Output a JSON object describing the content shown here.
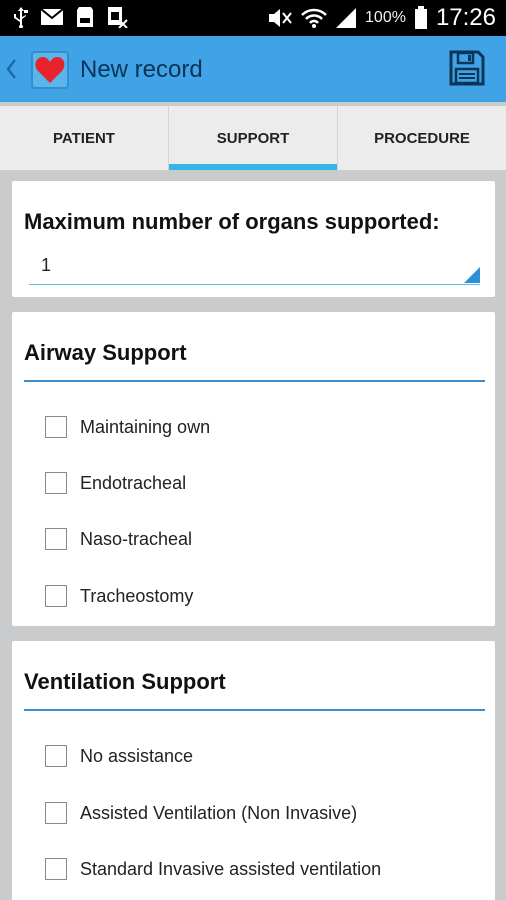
{
  "status_bar": {
    "battery_percent": "100%",
    "time": "17:26",
    "icons": [
      "usb-icon",
      "mail-icon",
      "storage-icon",
      "sim-off-icon",
      "mute-icon",
      "wifi-icon",
      "signal-icon",
      "battery-icon"
    ]
  },
  "action_bar": {
    "title": "New record",
    "back_icon": "chevron-left-icon",
    "app_icon": "heart-icon",
    "save_icon": "floppy-disk-icon",
    "color": "#3fa3e6"
  },
  "tabs": [
    {
      "label": "PATIENT",
      "active": false
    },
    {
      "label": "SUPPORT",
      "active": true
    },
    {
      "label": "PROCEDURE",
      "active": false
    }
  ],
  "organs": {
    "label": "Maximum number of organs supported:",
    "selected": "1"
  },
  "airway": {
    "title": "Airway Support",
    "options": [
      "Maintaining own",
      "Endotracheal",
      "Naso-tracheal",
      "Tracheostomy"
    ]
  },
  "ventilation": {
    "title": "Ventilation Support",
    "options": [
      "No assistance",
      "Assisted Ventilation (Non Invasive)",
      "Standard Invasive assisted ventilation"
    ]
  },
  "colors": {
    "accent": "#33b5e5",
    "section_rule": "#3a8ed0",
    "background": "#c9cbcc"
  }
}
